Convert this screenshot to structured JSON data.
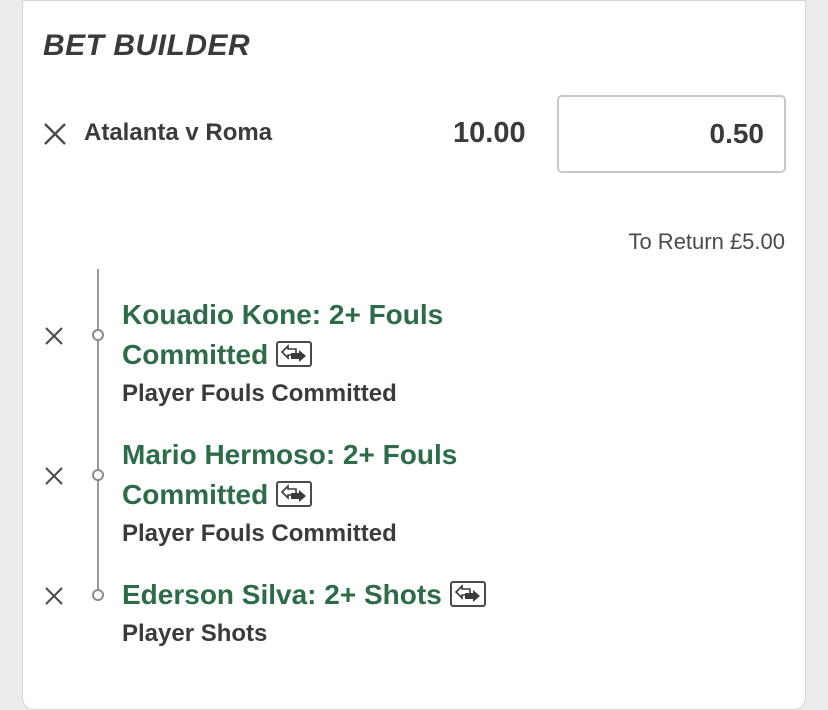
{
  "header": {
    "title": "BET BUILDER"
  },
  "bet": {
    "event": "Atalanta v Roma",
    "odds": "10.00",
    "stake": "0.50",
    "to_return": "To Return £5.00"
  },
  "selections": [
    {
      "title_line1": "Kouadio Kone: 2+ Fouls",
      "title_line2": "Committed",
      "market": "Player Fouls Committed"
    },
    {
      "title_line1": "Mario Hermoso: 2+ Fouls",
      "title_line2": "Committed",
      "market": "Player Fouls Committed"
    },
    {
      "title_line1": "Ederson Silva: 2+ Shots",
      "market": "Player Shots"
    }
  ],
  "colors": {
    "selection_green": "#2e6b48",
    "text": "#3b3b3b"
  },
  "icons": {
    "remove": "close-icon",
    "swap": "swap-icon"
  }
}
